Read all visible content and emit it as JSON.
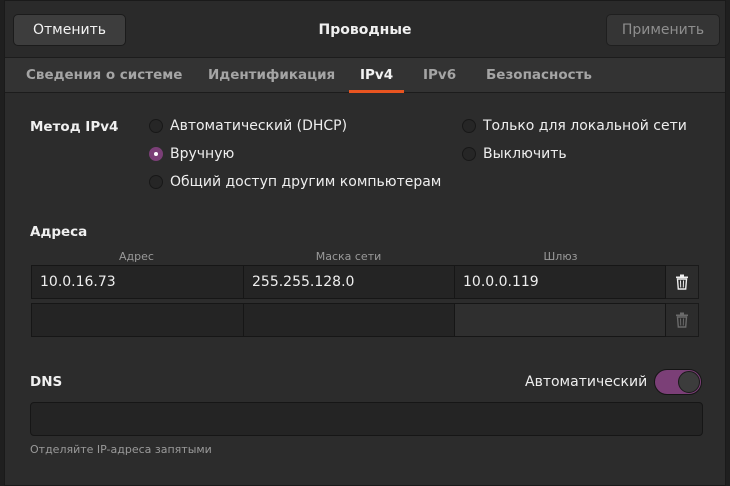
{
  "header": {
    "title": "Проводные",
    "cancel_label": "Отменить",
    "apply_label": "Применить"
  },
  "tabs": [
    {
      "label": "Сведения о системе",
      "active": false
    },
    {
      "label": "Идентификация",
      "active": false
    },
    {
      "label": "IPv4",
      "active": true
    },
    {
      "label": "IPv6",
      "active": false
    },
    {
      "label": "Безопасность",
      "active": false
    }
  ],
  "ipv4_method": {
    "label": "Метод IPv4",
    "options": [
      {
        "label": "Автоматический (DHCP)",
        "checked": false
      },
      {
        "label": "Вручную",
        "checked": true
      },
      {
        "label": "Общий доступ другим компьютерам",
        "checked": false
      },
      {
        "label": "Только для локальной сети",
        "checked": false
      },
      {
        "label": "Выключить",
        "checked": false
      }
    ]
  },
  "addresses": {
    "label": "Адреса",
    "columns": [
      "Адрес",
      "Маска сети",
      "Шлюз"
    ],
    "rows": [
      [
        "10.0.16.73",
        "255.255.128.0",
        "10.0.0.119"
      ],
      [
        "",
        "",
        ""
      ]
    ]
  },
  "dns": {
    "label": "DNS",
    "auto_label": "Автоматический",
    "auto_enabled": true,
    "value": "",
    "hint": "Отделяйте IP-адреса запятыми"
  },
  "colors": {
    "accent": "#e95420",
    "toggle_on": "#7b3f77",
    "radio_checked": "#7b3f77"
  }
}
